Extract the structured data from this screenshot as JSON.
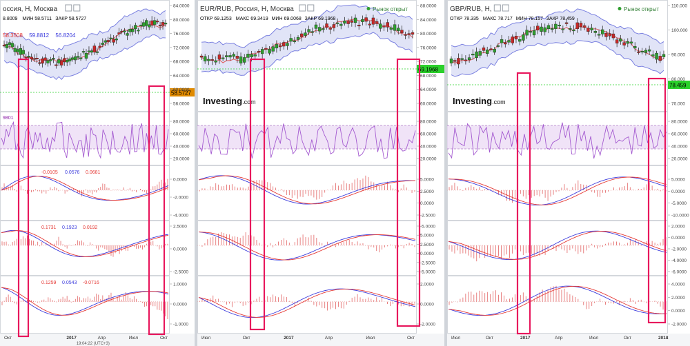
{
  "panels": [
    {
      "id": "usd",
      "title": "оссия, H, Москва",
      "status": "",
      "ohlc": [
        {
          "text": "8.8009",
          "color": "#000000"
        },
        {
          "text": "МИН 58.5711",
          "color": "#000000"
        },
        {
          "text": "ЗАКР 58.5727",
          "color": "#000000"
        }
      ],
      "boll": [
        {
          "text": "58.3508",
          "color": "#e53935"
        },
        {
          "text": "59.8812",
          "color": "#3b3bdd"
        },
        {
          "text": "56.8204",
          "color": "#3b3bdd"
        }
      ],
      "price_badge": "58.5727",
      "watermark": "",
      "rsi_label": "9801",
      "macd_labels": [
        [
          {
            "text": "-0.0105",
            "color": "#e53935"
          },
          {
            "text": "0.0576",
            "color": "#3b3bdd"
          },
          {
            "text": "0.0681",
            "color": "#e53935"
          }
        ],
        [
          {
            "text": "0.1731",
            "color": "#e53935"
          },
          {
            "text": "0.1923",
            "color": "#3b3bdd"
          },
          {
            "text": "0.0192",
            "color": "#e53935"
          }
        ],
        [
          {
            "text": "0.1259",
            "color": "#e53935"
          },
          {
            "text": "0.0543",
            "color": "#3b3bdd"
          },
          {
            "text": "-0.0716",
            "color": "#e53935"
          }
        ]
      ],
      "axis": {
        "main": [
          "84.0000",
          "80.0000",
          "76.0000",
          "72.0000",
          "68.0000",
          "64.0000",
          "60.0000",
          "56.0000"
        ],
        "rsi": [
          "80.0000",
          "60.0000",
          "40.0000",
          "20.0000"
        ],
        "m1": [
          "0.0000",
          "-2.0000",
          "-4.0000"
        ],
        "m2": [
          "2.5000",
          "0.0000",
          "-2.5000"
        ],
        "m3": [
          "1.0000",
          "0.0000",
          "-1.0000"
        ]
      },
      "time_labels": [
        "Окт",
        "",
        "2017",
        "Апр",
        "Июл",
        "Окт"
      ],
      "footer": "19:04:22 (UTC+3)"
    },
    {
      "id": "eur",
      "title": "EUR/RUB, Россия, H, Москва",
      "status": "Рынок открыт",
      "ohlc": [
        {
          "text": "ОТКР 69.1253",
          "color": "#000000"
        },
        {
          "text": "МАКС 69.3419",
          "color": "#000000"
        },
        {
          "text": "МИН 69.0068",
          "color": "#000000"
        },
        {
          "text": "ЗАКР 69.1968",
          "color": "#000000"
        }
      ],
      "boll": [],
      "price_badge": "69.1968",
      "watermark": "Investing",
      "watermark_suffix": ".com",
      "rsi_label": "",
      "macd_labels": [
        [],
        [],
        []
      ],
      "axis": {
        "main": [
          "88.0000",
          "84.0000",
          "80.0000",
          "76.0000",
          "72.0000",
          "68.0000",
          "64.0000",
          "60.0000"
        ],
        "rsi": [
          "80.0000",
          "60.0000",
          "40.0000",
          "20.0000"
        ],
        "m1": [
          "5.0000",
          "2.5000",
          "0.0000",
          "-2.5000"
        ],
        "m2": [
          "-5.0000",
          "5.0000",
          "2.5000",
          "0.0000",
          "-2.5000",
          "-5.0000"
        ],
        "m3": [
          "2.0000",
          "0.0000",
          "-2.0000"
        ]
      },
      "time_labels": [
        "Июл",
        "Окт",
        "2017",
        "Апр",
        "Июл",
        "Окт"
      ],
      "footer": ""
    },
    {
      "id": "gbp",
      "title": "GBP/RUB, H,",
      "status": "Рынок открыт",
      "ohlc": [
        {
          "text": "ОТКР 78.335",
          "color": "#000000"
        },
        {
          "text": "МАКС 78.717",
          "color": "#000000"
        },
        {
          "text": "МИН 78.157",
          "color": "#000000"
        },
        {
          "text": "ЗАКР 78.459",
          "color": "#000000"
        }
      ],
      "boll": [],
      "price_badge": "78.459",
      "watermark": "Investing",
      "watermark_suffix": ".com",
      "rsi_label": "",
      "macd_labels": [
        [],
        [],
        []
      ],
      "axis": {
        "main": [
          "110.000",
          "100.000",
          "90.000",
          "80.000",
          "70.000"
        ],
        "rsi": [
          "80.0000",
          "60.0000",
          "40.0000",
          "20.0000"
        ],
        "m1": [
          "5.0000",
          "0.0000",
          "-5.0000",
          "-10.0000"
        ],
        "m2": [
          "2.0000",
          "0.0000",
          "-2.0000",
          "-4.0000",
          "-6.0000"
        ],
        "m3": [
          "4.0000",
          "2.0000",
          "0.0000",
          "-2.0000"
        ]
      },
      "time_labels": [
        "Июл",
        "Окт",
        "2017",
        "Апр",
        "Июл",
        "Окт",
        "2018"
      ],
      "footer": ""
    }
  ],
  "colors": {
    "band_fill": "#c9cdf0",
    "band_edge": "#7a80e0",
    "ma": "#e05a5a",
    "bull": "#2e9e2e",
    "bear": "#c62828",
    "rsi_line": "#a45ad0",
    "rsi_zone": "#ead7f3",
    "macd": "#3b3bdd",
    "signal": "#e53935",
    "hist": "#e57373",
    "marker": "#e8175d",
    "badge_usd": "#e08a00",
    "badge_eur": "#2bd12b",
    "badge_gbp": "#2bd12b"
  }
}
